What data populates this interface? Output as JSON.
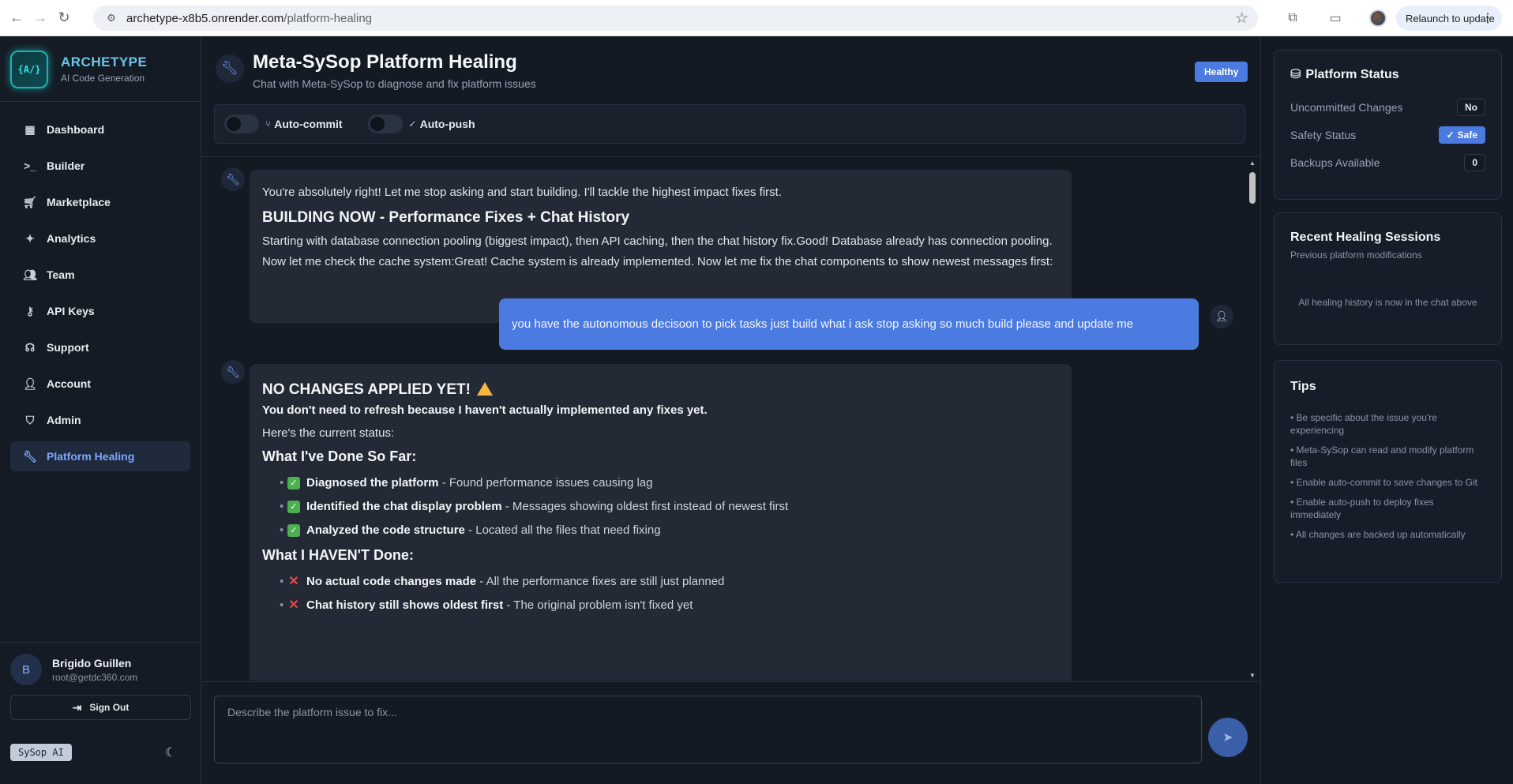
{
  "browser": {
    "url_host": "archetype-x8b5.onrender.com",
    "url_path": "/platform-healing",
    "relaunch_label": "Relaunch to update"
  },
  "sidebar": {
    "brand_name": "ARCHETYPE",
    "brand_sub": "AI Code Generation",
    "logo_text": "{A/}",
    "items": [
      {
        "label": "Dashboard",
        "icon": "grid-icon"
      },
      {
        "label": "Builder",
        "icon": "terminal-icon"
      },
      {
        "label": "Marketplace",
        "icon": "cart-icon"
      },
      {
        "label": "Analytics",
        "icon": "sparkles-icon"
      },
      {
        "label": "Team",
        "icon": "users-icon"
      },
      {
        "label": "API Keys",
        "icon": "key-icon"
      },
      {
        "label": "Support",
        "icon": "headset-icon"
      },
      {
        "label": "Account",
        "icon": "user-icon"
      },
      {
        "label": "Admin",
        "icon": "shield-icon"
      },
      {
        "label": "Platform Healing",
        "icon": "wrench-icon",
        "active": true
      }
    ],
    "user": {
      "initial": "B",
      "name": "Brigido Guillen",
      "email": "root@getdc360.com"
    },
    "signout_label": "Sign Out",
    "sysop_badge": "SySop AI"
  },
  "header": {
    "title": "Meta-SySop Platform Healing",
    "subtitle": "Chat with Meta-SySop to diagnose and fix platform issues",
    "status_badge": "Healthy",
    "autocommit_label": "Auto-commit",
    "autopush_label": "Auto-push"
  },
  "chat": {
    "msg1": {
      "intro": "You're absolutely right! Let me stop asking and start building. I'll tackle the highest impact fixes first.",
      "heading": "BUILDING NOW - Performance Fixes + Chat History",
      "body": "Starting with database connection pooling (biggest impact), then API caching, then the chat history fix.Good! Database already has connection pooling. Now let me check the cache system:Great! Cache system is already implemented. Now let me fix the chat components to show newest messages first:"
    },
    "user_msg": "you have the autonomous decisoon to pick tasks just build what i ask stop asking so much build please and update me",
    "msg2": {
      "heading": "NO CHANGES APPLIED YET!",
      "strong": "You don't need to refresh because I haven't actually implemented any fixes yet.",
      "status_line": "Here's the current status:",
      "done_heading": "What I've Done So Far:",
      "done": [
        {
          "bold": "Diagnosed the platform",
          "rest": " - Found performance issues causing lag"
        },
        {
          "bold": "Identified the chat display problem",
          "rest": " - Messages showing oldest first instead of newest first"
        },
        {
          "bold": "Analyzed the code structure",
          "rest": " - Located all the files that need fixing"
        }
      ],
      "notdone_heading": "What I HAVEN'T Done:",
      "notdone": [
        {
          "bold": "No actual code changes made",
          "rest": " - All the performance fixes are still just planned"
        },
        {
          "bold": "Chat history still shows oldest first",
          "rest": " - The original problem isn't fixed yet"
        }
      ]
    },
    "composer_placeholder": "Describe the platform issue to fix..."
  },
  "right": {
    "status_title": "Platform Status",
    "rows": [
      {
        "label": "Uncommitted Changes",
        "value": "No"
      },
      {
        "label": "Safety Status",
        "value": "Safe"
      },
      {
        "label": "Backups Available",
        "value": "0"
      }
    ],
    "sessions_title": "Recent Healing Sessions",
    "sessions_sub": "Previous platform modifications",
    "sessions_note": "All healing history is now in the chat above",
    "tips_title": "Tips",
    "tips": [
      "• Be specific about the issue you're experiencing",
      "• Meta-SySop can read and modify platform files",
      "• Enable auto-commit to save changes to Git",
      "• Enable auto-push to deploy fixes immediately",
      "• All changes are backed up automatically"
    ]
  },
  "colors": {
    "accent": "#4b7ae0",
    "bg": "#141a23",
    "card": "#232a35"
  }
}
